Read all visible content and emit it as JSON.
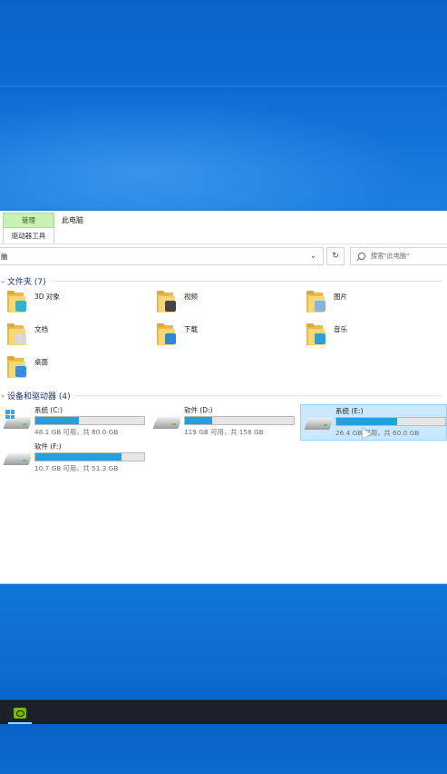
{
  "window": {
    "context_tab": "管理",
    "context_subtab": "驱动器工具",
    "title": "此电脑",
    "address_text": "脑",
    "address_chevron": "⌄",
    "refresh_glyph": "↻",
    "search_placeholder": "搜索\"此电脑\""
  },
  "sections": {
    "folders_header": "文件夹 (7)",
    "devices_header": "设备和驱动器 (4)"
  },
  "folders": [
    {
      "label": "3D 对象",
      "icon": "3d-objects-folder-icon",
      "badge_color": "#2fb3c8"
    },
    {
      "label": "视频",
      "icon": "videos-folder-icon",
      "badge_color": "#444444"
    },
    {
      "label": "图片",
      "icon": "pictures-folder-icon",
      "badge_color": "#7fb6e6"
    },
    {
      "label": "文档",
      "icon": "documents-folder-icon",
      "badge_color": "#d9d9d9"
    },
    {
      "label": "下载",
      "icon": "downloads-folder-icon",
      "badge_color": "#2f86d6"
    },
    {
      "label": "音乐",
      "icon": "music-folder-icon",
      "badge_color": "#2aa0d8"
    },
    {
      "label": "桌面",
      "icon": "desktop-folder-icon",
      "badge_color": "#2f8fe0"
    }
  ],
  "drives": [
    {
      "name": "系统 (C:)",
      "free": "48.1 GB 可用，共 80.0 GB",
      "used_fraction": 0.4,
      "system": true,
      "selected": false
    },
    {
      "name": "软件 (D:)",
      "free": "119 GB 可用，共 158 GB",
      "used_fraction": 0.25,
      "system": false,
      "selected": false
    },
    {
      "name": "系统 (E:)",
      "free": "26.4 GB 可用，共 60.0 GB",
      "used_fraction": 0.56,
      "system": false,
      "selected": true
    },
    {
      "name": "软件 (F:)",
      "free": "10.7 GB 可用，共 51.3 GB",
      "used_fraction": 0.79,
      "system": false,
      "selected": false
    }
  ],
  "colors": {
    "accent": "#26a0da",
    "section_header": "#1e3287",
    "context_tab_bg": "#c8f2b4",
    "selection_bg": "#cce8ff",
    "taskbar": "#1b2126",
    "nvidia_green": "#76b900"
  },
  "taskbar": {
    "apps": [
      {
        "icon": "nvidia-icon",
        "active": true
      }
    ]
  }
}
